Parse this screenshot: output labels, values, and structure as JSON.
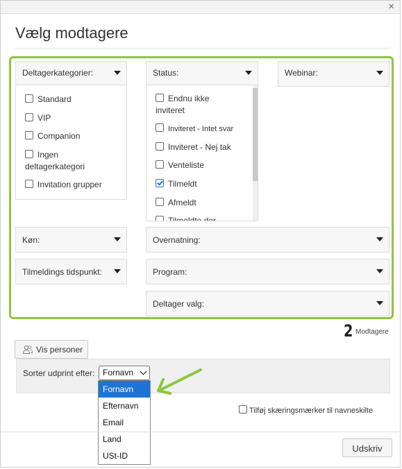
{
  "dialog": {
    "title": "Vælg modtagere",
    "close_glyph": "×"
  },
  "filters": {
    "deltagerkategorier": {
      "label": "Deltagerkategorier:",
      "options": [
        {
          "label": "Standard",
          "checked": false
        },
        {
          "label": "VIP",
          "checked": false
        },
        {
          "label": "Companion",
          "checked": false
        },
        {
          "label_line1": "Ingen",
          "label_line2": "deltagerkategori",
          "checked": false
        },
        {
          "label": "Invitation grupper",
          "checked": false
        }
      ]
    },
    "status": {
      "label": "Status:",
      "options": [
        {
          "label_line1": "Endnu ikke",
          "label_line2": "inviteret",
          "checked": false
        },
        {
          "label": "Inviteret - Intet svar",
          "checked": false
        },
        {
          "label": "Inviteret - Nej tak",
          "checked": false
        },
        {
          "label": "Venteliste",
          "checked": false
        },
        {
          "label": "Tilmeldt",
          "checked": true
        },
        {
          "label": "Afmeldt",
          "checked": false
        },
        {
          "label": "Tilmeldte der",
          "checked": false
        }
      ]
    },
    "webinar": {
      "label": "Webinar:"
    },
    "kon": {
      "label": "Køn:"
    },
    "overnatning": {
      "label": "Overnatning:"
    },
    "tilmeldings_tidspunkt": {
      "label": "Tilmeldings tidspunkt:"
    },
    "program": {
      "label": "Program:"
    },
    "deltager_valg": {
      "label": "Deltager valg:"
    }
  },
  "recipients": {
    "count": "2",
    "label": "Modtagere"
  },
  "vis_personer": {
    "label": "Vis personer",
    "icon": "people-icon"
  },
  "sort": {
    "label": "Sorter udprint efter:",
    "selected": "Fornavn",
    "options": [
      "Fornavn",
      "Efternavn",
      "Email",
      "Land",
      "USt-ID"
    ]
  },
  "crop_marks": {
    "label": "Tilføj skæringsmærker til navneskilte",
    "checked": false
  },
  "print_button": {
    "label": "Udskriv"
  },
  "colors": {
    "accent_frame": "#8dc63f",
    "annotation_arrow": "#8dc63f",
    "selected_option": "#1e74d6"
  }
}
